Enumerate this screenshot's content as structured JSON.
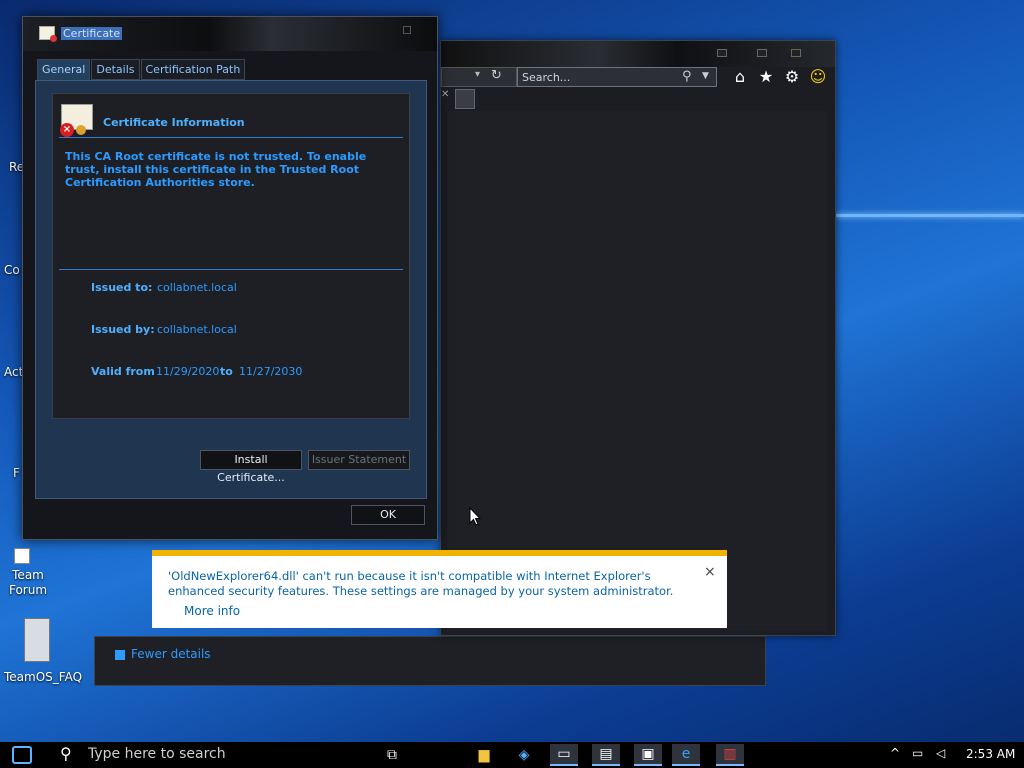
{
  "certificate_dialog": {
    "title": "Certificate",
    "tabs": [
      {
        "label": "General"
      },
      {
        "label": "Details"
      },
      {
        "label": "Certification Path"
      }
    ],
    "heading": "Certificate Information",
    "warning": "This CA Root certificate is not trusted. To enable trust, install this certificate in the Trusted Root Certification Authorities store.",
    "issued_to_label": "Issued to:",
    "issued_to_value": "collabnet.local",
    "issued_by_label": "Issued by:",
    "issued_by_value": "collabnet.local",
    "valid_from_label": "Valid from",
    "valid_from_value": "11/29/2020",
    "valid_to_label": "to",
    "valid_to_value": "11/27/2030",
    "install_button": "Install Certificate...",
    "issuer_statement_button": "Issuer Statement",
    "ok_button": "OK"
  },
  "browser": {
    "search_placeholder": "Search...",
    "fewer_details": "Fewer details"
  },
  "notification": {
    "message": "'OldNewExplorer64.dll' can't run because it isn't compatible with Internet Explorer's enhanced security features. These settings are managed by your system administrator.",
    "more_info": "More info",
    "close": "×"
  },
  "desktop": {
    "icons": [
      {
        "label": "Re"
      },
      {
        "label": "Co"
      },
      {
        "label": "Act"
      },
      {
        "label": "F"
      },
      {
        "label": "Team\nForum"
      },
      {
        "label": "TeamOS_FAQ"
      }
    ]
  },
  "taskbar": {
    "search_placeholder": "Type here to search",
    "clock": "2:53 AM"
  },
  "colors": {
    "accent": "#2b9bff",
    "notification_bar": "#f2b200",
    "error": "#d62020"
  }
}
